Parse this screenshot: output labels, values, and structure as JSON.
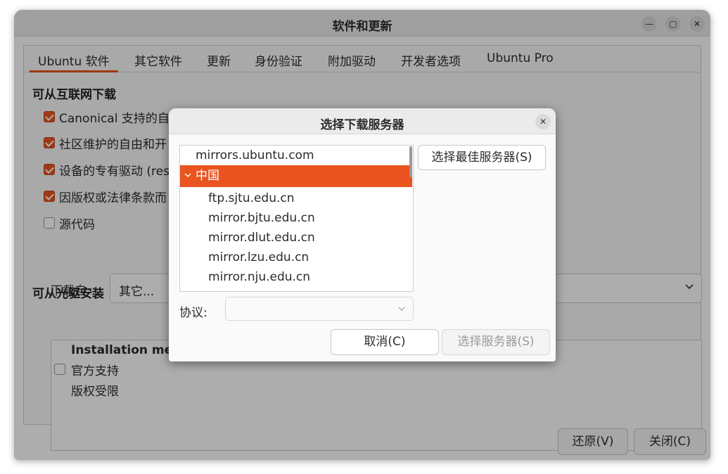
{
  "window": {
    "title": "软件和更新",
    "minimize_glyph": "—",
    "maximize_glyph": "▢",
    "close_glyph": "✕"
  },
  "tabs": [
    {
      "label": "Ubuntu 软件",
      "active": true
    },
    {
      "label": "其它软件"
    },
    {
      "label": "更新"
    },
    {
      "label": "身份验证"
    },
    {
      "label": "附加驱动"
    },
    {
      "label": "开发者选项"
    },
    {
      "label": "Ubuntu Pro"
    }
  ],
  "internet": {
    "heading": "可从互联网下载",
    "items": [
      {
        "label": "Canonical 支持的自",
        "checked": true
      },
      {
        "label": "社区维护的自由和开",
        "checked": true
      },
      {
        "label": "设备的专有驱动 (res",
        "checked": true
      },
      {
        "label": "因版权或法律条款而",
        "checked": true
      },
      {
        "label": "源代码",
        "checked": false
      }
    ],
    "download_from_label": "下载自:",
    "download_from_value": "其它..."
  },
  "cdrom": {
    "heading": "可从光驱安装",
    "name": "Installation mediu",
    "official": "官方支持",
    "official_checked": false,
    "restricted": "版权受限"
  },
  "footer": {
    "revert_label": "还原(V)",
    "close_label": "关闭(C)"
  },
  "dialog": {
    "title": "选择下载服务器",
    "close_glyph": "✕",
    "main_server": "mirrors.ubuntu.com",
    "country": "中国",
    "mirrors": [
      "ftp.sjtu.edu.cn",
      "mirror.bjtu.edu.cn",
      "mirror.dlut.edu.cn",
      "mirror.lzu.edu.cn",
      "mirror.nju.edu.cn"
    ],
    "best_server_label": "选择最佳服务器(S)",
    "protocol_label": "协议:",
    "protocol_value": "",
    "cancel_label": "取消(C)",
    "choose_server_label": "选择服务器(S)"
  },
  "colors": {
    "accent": "#e95420",
    "window_bg": "#fafafa",
    "titlebar_bg": "#ebebeb"
  }
}
